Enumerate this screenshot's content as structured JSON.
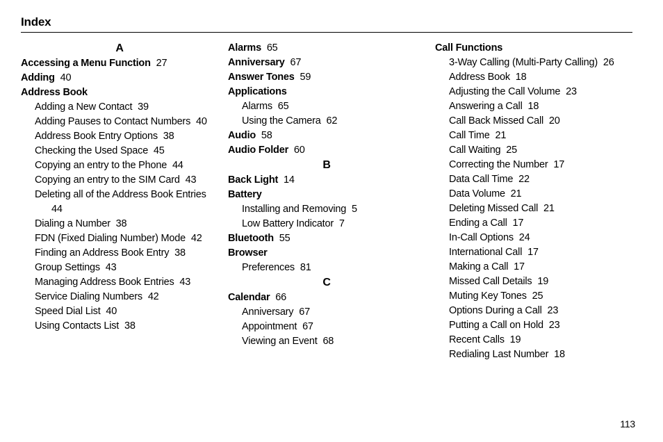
{
  "title": "Index",
  "page_number": "113",
  "columns": [
    {
      "blocks": [
        {
          "type": "letter",
          "text": "A"
        },
        {
          "type": "entry",
          "bold": true,
          "label": "Accessing a Menu Function",
          "page": "27"
        },
        {
          "type": "entry",
          "bold": true,
          "label": "Adding",
          "page": "40"
        },
        {
          "type": "entry",
          "bold": true,
          "label": "Address Book",
          "page": ""
        },
        {
          "type": "sub",
          "label": "Adding a New Contact",
          "page": "39"
        },
        {
          "type": "sub",
          "label": "Adding Pauses to Contact Numbers",
          "page": "40"
        },
        {
          "type": "sub",
          "label": "Address Book Entry Options",
          "page": "38"
        },
        {
          "type": "sub",
          "label": "Checking the Used Space",
          "page": "45"
        },
        {
          "type": "sub",
          "label": "Copying an entry to the Phone",
          "page": "44"
        },
        {
          "type": "sub",
          "label": "Copying an entry to the SIM Card",
          "page": "43"
        },
        {
          "type": "sub",
          "label": "Deleting all of the Address Book Entries",
          "page": "44"
        },
        {
          "type": "sub",
          "label": "Dialing a Number",
          "page": "38"
        },
        {
          "type": "sub",
          "label": "FDN (Fixed Dialing Number) Mode",
          "page": "42"
        },
        {
          "type": "sub",
          "label": "Finding an Address Book Entry",
          "page": "38"
        },
        {
          "type": "sub",
          "label": "Group Settings",
          "page": "43"
        },
        {
          "type": "sub",
          "label": "Managing Address Book Entries",
          "page": "43"
        },
        {
          "type": "sub",
          "label": "Service Dialing Numbers",
          "page": "42"
        },
        {
          "type": "sub",
          "label": "Speed Dial List",
          "page": "40"
        },
        {
          "type": "sub",
          "label": "Using Contacts List",
          "page": "38"
        }
      ]
    },
    {
      "blocks": [
        {
          "type": "entry",
          "bold": true,
          "label": "Alarms",
          "page": "65"
        },
        {
          "type": "entry",
          "bold": true,
          "label": "Anniversary",
          "page": "67"
        },
        {
          "type": "entry",
          "bold": true,
          "label": "Answer Tones",
          "page": "59"
        },
        {
          "type": "entry",
          "bold": true,
          "label": "Applications",
          "page": ""
        },
        {
          "type": "sub",
          "label": "Alarms",
          "page": "65"
        },
        {
          "type": "sub",
          "label": "Using the Camera",
          "page": "62"
        },
        {
          "type": "entry",
          "bold": true,
          "label": "Audio",
          "page": "58"
        },
        {
          "type": "entry",
          "bold": true,
          "label": "Audio Folder",
          "page": "60"
        },
        {
          "type": "letter",
          "text": "B"
        },
        {
          "type": "entry",
          "bold": true,
          "label": "Back Light",
          "page": "14"
        },
        {
          "type": "entry",
          "bold": true,
          "label": "Battery",
          "page": ""
        },
        {
          "type": "sub",
          "label": "Installing and Removing",
          "page": "5"
        },
        {
          "type": "sub",
          "label": "Low Battery Indicator",
          "page": "7"
        },
        {
          "type": "entry",
          "bold": true,
          "label": "Bluetooth",
          "page": "55"
        },
        {
          "type": "entry",
          "bold": true,
          "label": "Browser",
          "page": ""
        },
        {
          "type": "sub",
          "label": "Preferences",
          "page": "81"
        },
        {
          "type": "letter",
          "text": "C"
        },
        {
          "type": "entry",
          "bold": true,
          "label": "Calendar",
          "page": "66"
        },
        {
          "type": "sub",
          "label": "Anniversary",
          "page": "67"
        },
        {
          "type": "sub",
          "label": "Appointment",
          "page": "67"
        },
        {
          "type": "sub",
          "label": "Viewing an Event",
          "page": "68"
        }
      ]
    },
    {
      "blocks": [
        {
          "type": "entry",
          "bold": true,
          "label": "Call Functions",
          "page": ""
        },
        {
          "type": "sub",
          "label": "3-Way Calling (Multi-Party Calling)",
          "page": "26"
        },
        {
          "type": "sub",
          "label": "Address Book",
          "page": "18"
        },
        {
          "type": "sub",
          "label": "Adjusting the Call Volume",
          "page": "23"
        },
        {
          "type": "sub",
          "label": "Answering a Call",
          "page": "18"
        },
        {
          "type": "sub",
          "label": "Call Back Missed Call",
          "page": "20"
        },
        {
          "type": "sub",
          "label": "Call Time",
          "page": "21"
        },
        {
          "type": "sub",
          "label": "Call Waiting",
          "page": "25"
        },
        {
          "type": "sub",
          "label": "Correcting the Number",
          "page": "17"
        },
        {
          "type": "sub",
          "label": "Data Call Time",
          "page": "22"
        },
        {
          "type": "sub",
          "label": "Data Volume",
          "page": "21"
        },
        {
          "type": "sub",
          "label": "Deleting Missed Call",
          "page": "21"
        },
        {
          "type": "sub",
          "label": "Ending a Call",
          "page": "17"
        },
        {
          "type": "sub",
          "label": "In-Call Options",
          "page": "24"
        },
        {
          "type": "sub",
          "label": "International Call",
          "page": "17"
        },
        {
          "type": "sub",
          "label": "Making a Call",
          "page": "17"
        },
        {
          "type": "sub",
          "label": "Missed Call Details",
          "page": "19"
        },
        {
          "type": "sub",
          "label": "Muting Key Tones",
          "page": "25"
        },
        {
          "type": "sub",
          "label": "Options During a Call",
          "page": "23"
        },
        {
          "type": "sub",
          "label": "Putting a Call on Hold",
          "page": "23"
        },
        {
          "type": "sub",
          "label": "Recent Calls",
          "page": "19"
        },
        {
          "type": "sub",
          "label": "Redialing Last Number",
          "page": "18"
        }
      ]
    }
  ]
}
